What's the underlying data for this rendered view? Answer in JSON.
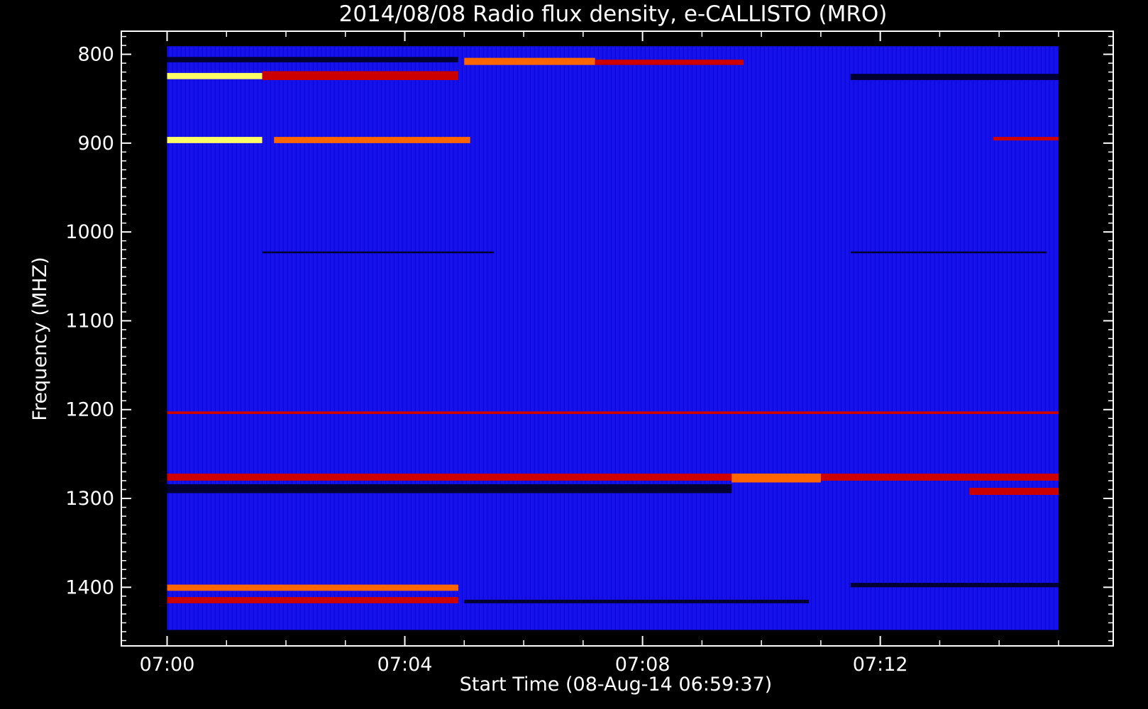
{
  "chart_data": {
    "type": "heatmap",
    "title": "2014/08/08  Radio flux density, e-CALLISTO (MRO)",
    "xlabel": "Start Time (08-Aug-14 06:59:37)",
    "ylabel": "Frequency (MHZ)",
    "x_tick_labels": [
      "07:00",
      "07:04",
      "07:08",
      "07:12"
    ],
    "x_tick_minutes": [
      0,
      4,
      8,
      12
    ],
    "y_tick_labels": [
      "800",
      "900",
      "1000",
      "1100",
      "1200",
      "1300",
      "1400"
    ],
    "y_tick_values": [
      800,
      900,
      1000,
      1100,
      1200,
      1300,
      1400
    ],
    "ylim": [
      1466,
      774
    ],
    "xlim_minutes": [
      -0.77,
      15.92
    ],
    "data_extent": {
      "t_start_min": 0.0,
      "t_end_min": 15.0,
      "f_top_mhz": 791,
      "f_bottom_mhz": 1448
    },
    "colors": {
      "background": "#0000ff",
      "dark": "#000033",
      "red": "#cc0000",
      "orange": "#ff6600",
      "yellow": "#ffff66"
    },
    "features": [
      {
        "kind": "hot",
        "f1": 821,
        "f2": 828,
        "t1": 0.0,
        "t2": 1.6,
        "level": "yellow"
      },
      {
        "kind": "hot",
        "f1": 819,
        "f2": 829,
        "t1": 1.6,
        "t2": 4.9,
        "level": "red"
      },
      {
        "kind": "dark",
        "f1": 803,
        "f2": 809,
        "t1": 0.0,
        "t2": 4.9,
        "level": "dark"
      },
      {
        "kind": "hot",
        "f1": 804,
        "f2": 812,
        "t1": 5.0,
        "t2": 7.2,
        "level": "orange"
      },
      {
        "kind": "hot",
        "f1": 806,
        "f2": 812,
        "t1": 7.2,
        "t2": 9.7,
        "level": "red"
      },
      {
        "kind": "dark",
        "f1": 822,
        "f2": 829,
        "t1": 11.5,
        "t2": 15.0,
        "level": "dark"
      },
      {
        "kind": "hot",
        "f1": 893,
        "f2": 900,
        "t1": 0.0,
        "t2": 1.6,
        "level": "yellow"
      },
      {
        "kind": "hot",
        "f1": 893,
        "f2": 900,
        "t1": 1.8,
        "t2": 5.1,
        "level": "orange"
      },
      {
        "kind": "hot",
        "f1": 893,
        "f2": 897,
        "t1": 13.9,
        "t2": 15.0,
        "level": "red"
      },
      {
        "kind": "dark",
        "f1": 1022,
        "f2": 1024,
        "t1": 1.6,
        "t2": 5.5,
        "level": "dark"
      },
      {
        "kind": "dark",
        "f1": 1022,
        "f2": 1024,
        "t1": 11.5,
        "t2": 14.8,
        "level": "dark"
      },
      {
        "kind": "hot",
        "f1": 1202,
        "f2": 1205,
        "t1": 0.0,
        "t2": 15.0,
        "level": "red"
      },
      {
        "kind": "hot",
        "f1": 1272,
        "f2": 1280,
        "t1": 0.0,
        "t2": 15.0,
        "level": "red"
      },
      {
        "kind": "hot",
        "f1": 1272,
        "f2": 1282,
        "t1": 9.5,
        "t2": 11.0,
        "level": "orange"
      },
      {
        "kind": "dark",
        "f1": 1284,
        "f2": 1294,
        "t1": 0.0,
        "t2": 9.5,
        "level": "dark"
      },
      {
        "kind": "hot",
        "f1": 1288,
        "f2": 1296,
        "t1": 13.5,
        "t2": 15.0,
        "level": "red"
      },
      {
        "kind": "hot",
        "f1": 1397,
        "f2": 1404,
        "t1": 0.0,
        "t2": 4.9,
        "level": "orange"
      },
      {
        "kind": "hot",
        "f1": 1411,
        "f2": 1418,
        "t1": 0.0,
        "t2": 4.9,
        "level": "red"
      },
      {
        "kind": "dark",
        "f1": 1395,
        "f2": 1400,
        "t1": 11.5,
        "t2": 15.0,
        "level": "dark"
      },
      {
        "kind": "dark",
        "f1": 1414,
        "f2": 1418,
        "t1": 5.0,
        "t2": 10.8,
        "level": "dark"
      }
    ]
  }
}
